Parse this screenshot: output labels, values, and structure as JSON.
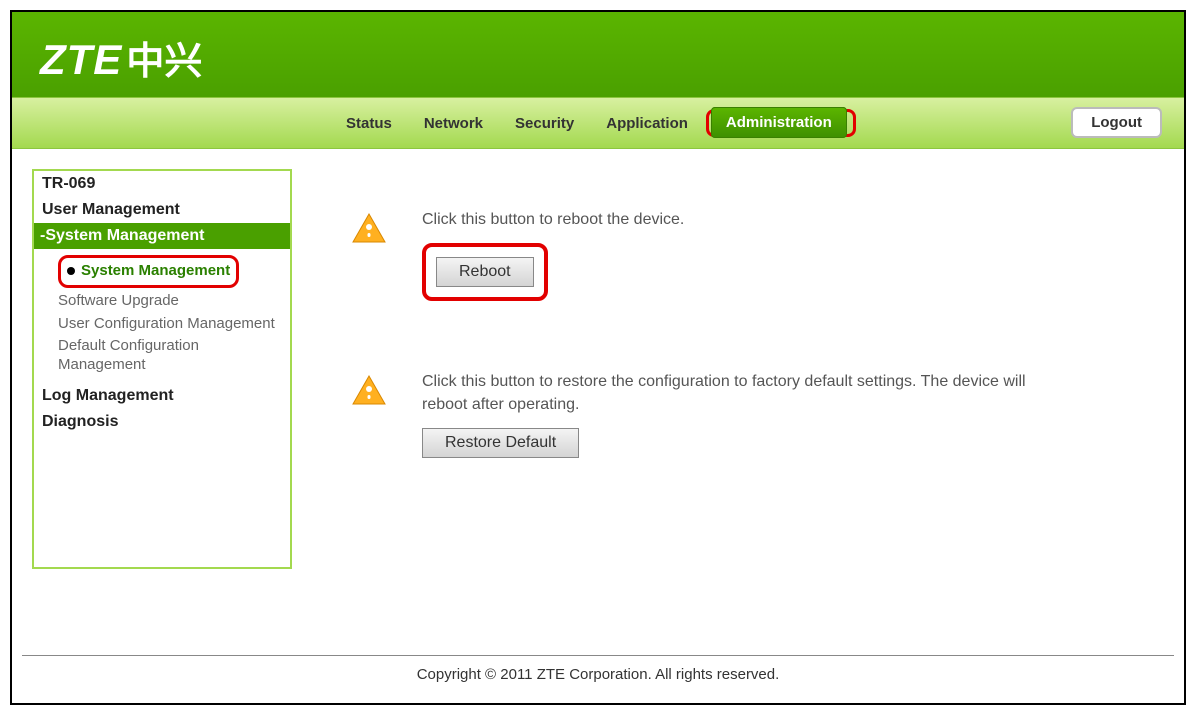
{
  "brand": {
    "latin": "ZTE",
    "cn": "中兴"
  },
  "tabs": {
    "items": [
      "Status",
      "Network",
      "Security",
      "Application",
      "Administration"
    ],
    "active_index": 4
  },
  "logout_label": "Logout",
  "sidebar": {
    "sections": [
      {
        "label": "TR-069"
      },
      {
        "label": "User Management"
      },
      {
        "label": "-System Management",
        "expanded": true,
        "children": [
          "System Management",
          "Software Upgrade",
          "User Configuration Management",
          "Default Configuration Management"
        ],
        "active_child_index": 0
      },
      {
        "label": "Log Management"
      },
      {
        "label": "Diagnosis"
      }
    ]
  },
  "main": {
    "reboot": {
      "text": "Click this button to reboot the device.",
      "button": "Reboot"
    },
    "restore": {
      "text": "Click this button to restore the configuration to factory default settings. The device will reboot after operating.",
      "button": "Restore Default"
    }
  },
  "footer": "Copyright © 2011 ZTE Corporation. All rights reserved."
}
